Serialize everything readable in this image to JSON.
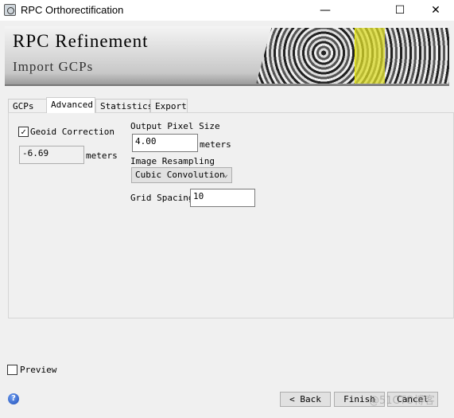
{
  "window": {
    "title": "RPC Orthorectification",
    "minimize": "—",
    "maximize": "☐",
    "close": "✕"
  },
  "banner": {
    "title": "RPC Refinement",
    "subtitle": "Import GCPs"
  },
  "tabs": [
    {
      "label": "GCPs"
    },
    {
      "label": "Advanced",
      "active": true
    },
    {
      "label": "Statistics"
    },
    {
      "label": "Export"
    }
  ],
  "advanced": {
    "geoid_correction": {
      "label": "Geoid Correction",
      "checked": true,
      "value": "-6.69",
      "unit": "meters"
    },
    "output_pixel_size": {
      "label": "Output Pixel Size",
      "value": "4.00",
      "unit": "meters"
    },
    "image_resampling": {
      "label": "Image Resampling",
      "selected": "Cubic Convolution"
    },
    "grid_spacing": {
      "label": "Grid Spacing",
      "value": "10"
    }
  },
  "preview": {
    "label": "Preview",
    "checked": false
  },
  "footer": {
    "help": "?",
    "back": "< Back",
    "finish": "Finish",
    "cancel": "Cancel"
  },
  "watermark": "@51CTO博客"
}
